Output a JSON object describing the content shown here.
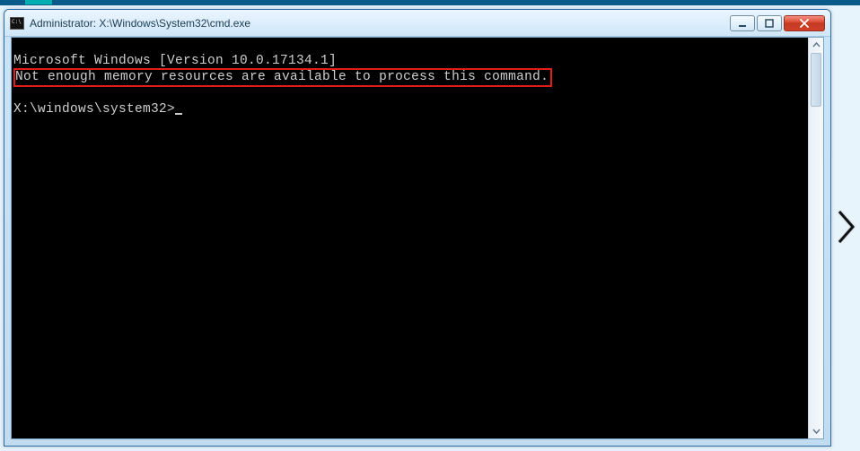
{
  "window": {
    "title": "Administrator: X:\\Windows\\System32\\cmd.exe"
  },
  "console": {
    "version_line": "Microsoft Windows [Version 10.0.17134.1]",
    "error_line": "Not enough memory resources are available to process this command.",
    "prompt": "X:\\windows\\system32>"
  },
  "controls": {
    "minimize_label": "Minimize",
    "maximize_label": "Maximize",
    "close_label": "Close"
  }
}
